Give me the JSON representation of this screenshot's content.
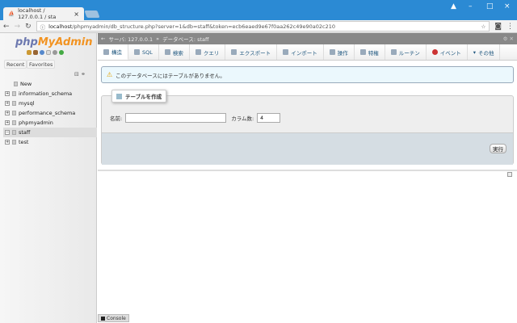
{
  "browser": {
    "tab_title": "localhost / 127.0.0.1 / sta",
    "url_host": "localhost",
    "url_path": "/phpmyadmin/db_structure.php?server=1&db=staff&token=ecb6eaed9e67f0aa262c49e90a02c210"
  },
  "sidebar": {
    "logo_php": "php",
    "logo_ma": "MyAdmin",
    "recent": "Recent",
    "favorites": "Favorites",
    "databases": [
      {
        "name": "New"
      },
      {
        "name": "information_schema"
      },
      {
        "name": "mysql"
      },
      {
        "name": "performance_schema"
      },
      {
        "name": "phpmyadmin"
      },
      {
        "name": "staff",
        "selected": true
      },
      {
        "name": "test"
      }
    ]
  },
  "breadcrumb": {
    "server": "サーバ: 127.0.0.1",
    "database": "データベース: staff"
  },
  "tabs": [
    "構造",
    "SQL",
    "検索",
    "クエリ",
    "エクスポート",
    "インポート",
    "操作",
    "特権",
    "ルーチン",
    "イベント",
    "その他"
  ],
  "notice": "このデータベースにはテーブルがありません。",
  "create_table": {
    "legend": "テーブルを作成",
    "name_label": "名前:",
    "name_value": "",
    "columns_label": "カラム数:",
    "columns_value": "4",
    "go": "実行"
  },
  "console": "Console",
  "colors": {
    "titlebar": "#2b8ad4",
    "logo_php": "#6c78af",
    "logo_ma": "#f29321"
  }
}
